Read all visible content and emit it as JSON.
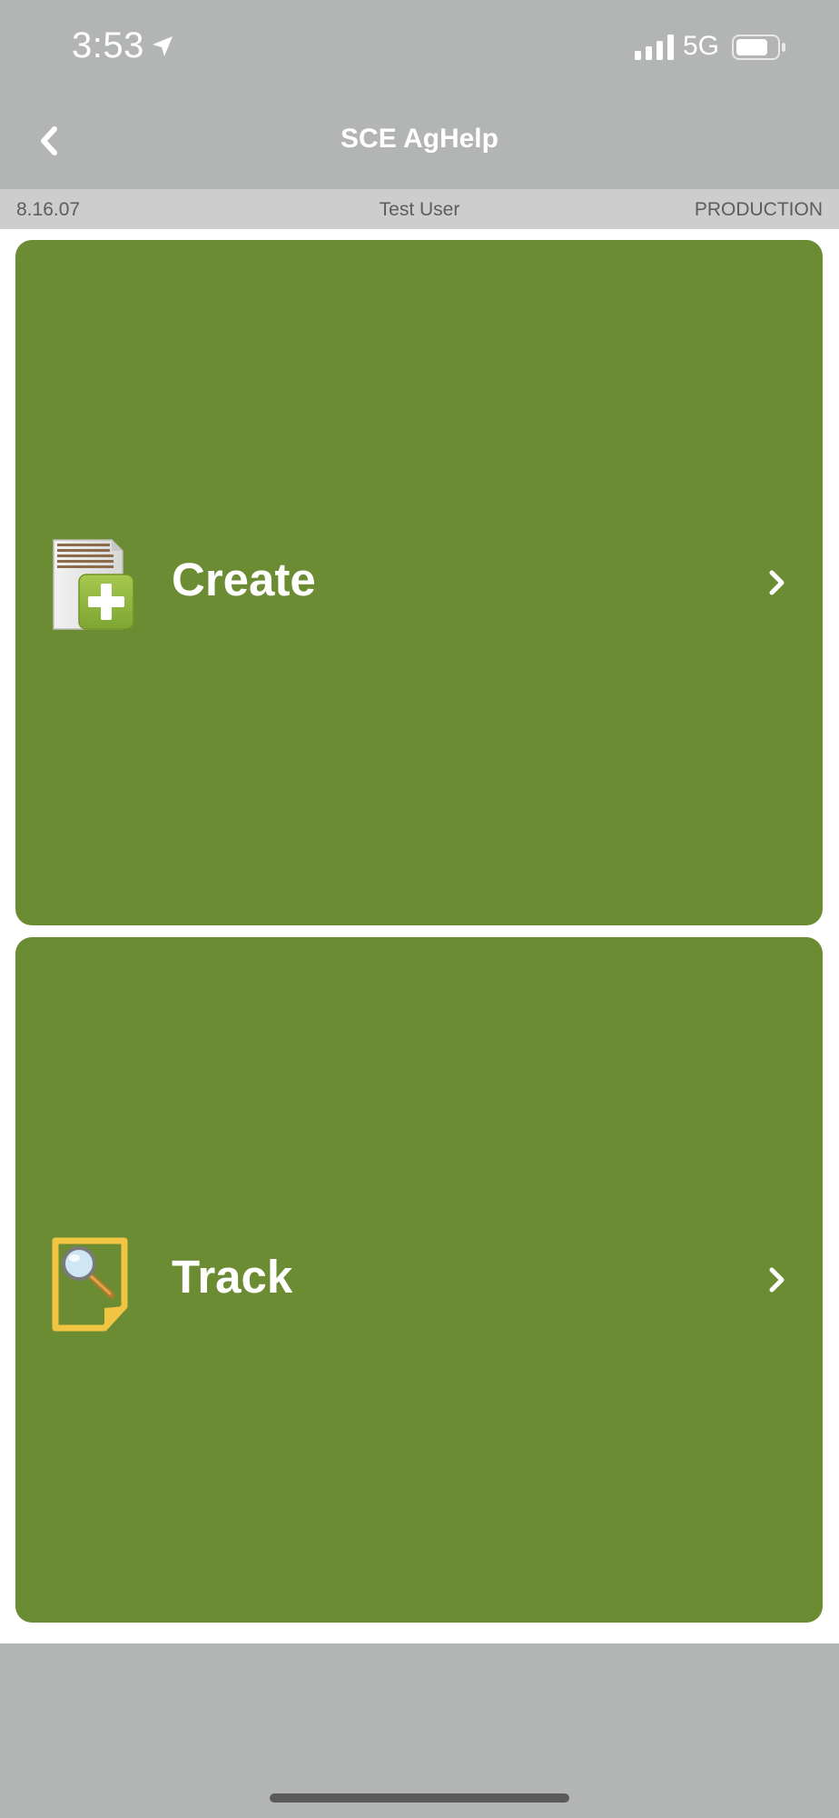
{
  "status_bar": {
    "time": "3:53",
    "network": "5G",
    "icons": [
      "location-arrow-icon",
      "signal-icon",
      "battery-icon"
    ]
  },
  "nav": {
    "title": "SCE AgHelp",
    "back_icon": "chevron-left-icon"
  },
  "info_bar": {
    "version": "8.16.07",
    "user": "Test User",
    "environment": "PRODUCTION"
  },
  "tiles": [
    {
      "label": "Create",
      "icon": "document-add-icon"
    },
    {
      "label": "Track",
      "icon": "document-search-icon"
    }
  ],
  "colors": {
    "tile_background": "#6c8c33",
    "header_background": "#b3b4b4",
    "info_bar_background": "#cdcdcd"
  }
}
